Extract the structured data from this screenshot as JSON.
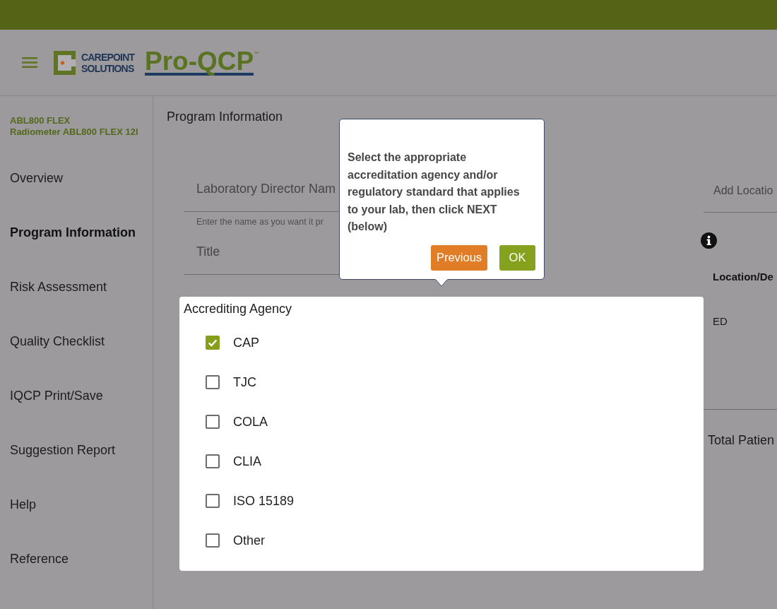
{
  "header": {
    "logo": {
      "company": "CAREPOINT SOLUTIONS",
      "product": "Pro-QCP",
      "trademark": "™"
    }
  },
  "sidebar": {
    "device": {
      "model": "ABL800 FLEX",
      "name": "Radiometer ABL800 FLEX 12l"
    },
    "items": [
      {
        "label": "Overview",
        "selected": false
      },
      {
        "label": "Program Information",
        "selected": true
      },
      {
        "label": "Risk Assessment",
        "selected": false
      },
      {
        "label": "Quality Checklist",
        "selected": false
      },
      {
        "label": "IQCP Print/Save",
        "selected": false
      },
      {
        "label": "Suggestion Report",
        "selected": false
      },
      {
        "label": "Help",
        "selected": false
      },
      {
        "label": "Reference",
        "selected": false
      }
    ]
  },
  "main": {
    "heading": "Program Information",
    "fields": [
      {
        "placeholder": "Laboratory Director Nam",
        "hint": "Enter the name as you want it pr"
      },
      {
        "placeholder": "Title"
      }
    ],
    "location": {
      "placeholder": "Add Locatio",
      "column_header": "Location/De",
      "cells": [
        "ED"
      ],
      "total_label": "Total Patien"
    },
    "accrediting_agency": {
      "title": "Accrediting Agency",
      "options": [
        {
          "label": "CAP",
          "checked": true
        },
        {
          "label": "TJC",
          "checked": false
        },
        {
          "label": "COLA",
          "checked": false
        },
        {
          "label": "CLIA",
          "checked": false
        },
        {
          "label": "ISO 15189",
          "checked": false
        },
        {
          "label": "Other",
          "checked": false
        }
      ]
    }
  },
  "tour_popover": {
    "message": "Select the appropriate accreditation agency and/or regulatory standard that applies to your lab, then click NEXT (below)",
    "buttons": [
      {
        "label": "Previous",
        "kind": "secondary"
      },
      {
        "label": "OK",
        "kind": "primary"
      }
    ]
  }
}
